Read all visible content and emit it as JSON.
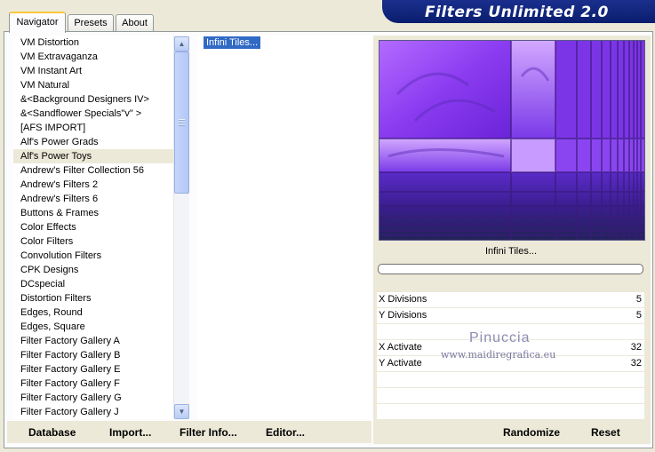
{
  "app": {
    "title": "Filters Unlimited 2.0"
  },
  "tabs": [
    {
      "label": "Navigator",
      "active": true
    },
    {
      "label": "Presets",
      "active": false
    },
    {
      "label": "About",
      "active": false
    }
  ],
  "categories": {
    "items": [
      "VM Distortion",
      "VM Extravaganza",
      "VM Instant Art",
      "VM Natural",
      "&<Background Designers IV>",
      "&<Sandflower Specials\"v\" >",
      "[AFS IMPORT]",
      "Alf's Power Grads",
      "Alf's Power Toys",
      "Andrew's Filter Collection 56",
      "Andrew's Filters 2",
      "Andrew's Filters 6",
      "Buttons & Frames",
      "Color Effects",
      "Color Filters",
      "Convolution Filters",
      "CPK Designs",
      "DCspecial",
      "Distortion Filters",
      "Edges, Round",
      "Edges, Square",
      "Filter Factory Gallery A",
      "Filter Factory Gallery B",
      "Filter Factory Gallery E",
      "Filter Factory Gallery F",
      "Filter Factory Gallery G",
      "Filter Factory Gallery J"
    ],
    "selected": "Alf's Power Toys"
  },
  "scrollbar": {
    "up_icon": "scroll-up-arrow",
    "down_icon": "scroll-down-arrow"
  },
  "filters": {
    "selected": "Infini Tiles..."
  },
  "preview": {
    "filter_name": "Infini Tiles...",
    "colors": {
      "purple": "#8a3bf0",
      "deep_blue": "#23235a",
      "lavender": "#d2a8ff"
    }
  },
  "params": [
    {
      "label": "X Divisions",
      "value": "5"
    },
    {
      "label": "Y Divisions",
      "value": "5"
    },
    {
      "label": "",
      "value": ""
    },
    {
      "label": "X Activate",
      "value": "32"
    },
    {
      "label": "Y Activate",
      "value": "32"
    },
    {
      "label": "",
      "value": ""
    },
    {
      "label": "",
      "value": ""
    },
    {
      "label": "",
      "value": ""
    }
  ],
  "watermark": {
    "name": "Pinuccia",
    "url": "www.maidiregrafica.eu"
  },
  "buttons": {
    "database": "Database",
    "import": "Import...",
    "filter_info": "Filter Info...",
    "editor": "Editor...",
    "randomize": "Randomize",
    "reset": "Reset"
  }
}
